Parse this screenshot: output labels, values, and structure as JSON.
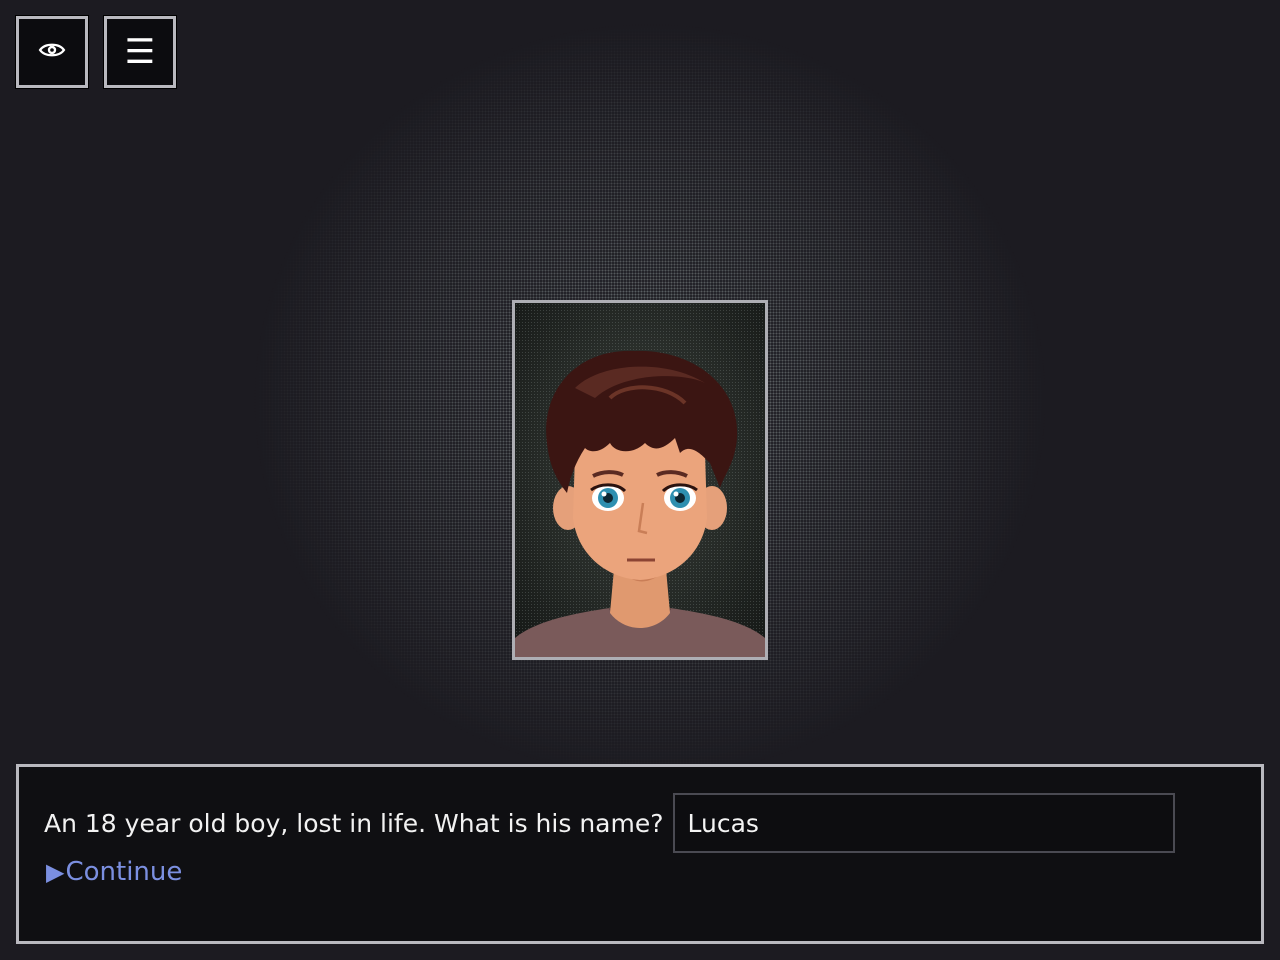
{
  "toolbar": {
    "eye_icon": "eye-icon",
    "menu_icon": "hamburger-menu-icon",
    "menu_glyph": "☰"
  },
  "portrait": {
    "subject": "character-portrait"
  },
  "dialog": {
    "prompt": "An 18 year old boy, lost in life. What is his name?",
    "name_value": "Lucas",
    "continue_arrow": "▶",
    "continue_label": "Continue"
  },
  "colors": {
    "background": "#1c1b21",
    "panel": "#0f0f12",
    "border": "#b9b9bf",
    "link": "#7b8fe0"
  }
}
